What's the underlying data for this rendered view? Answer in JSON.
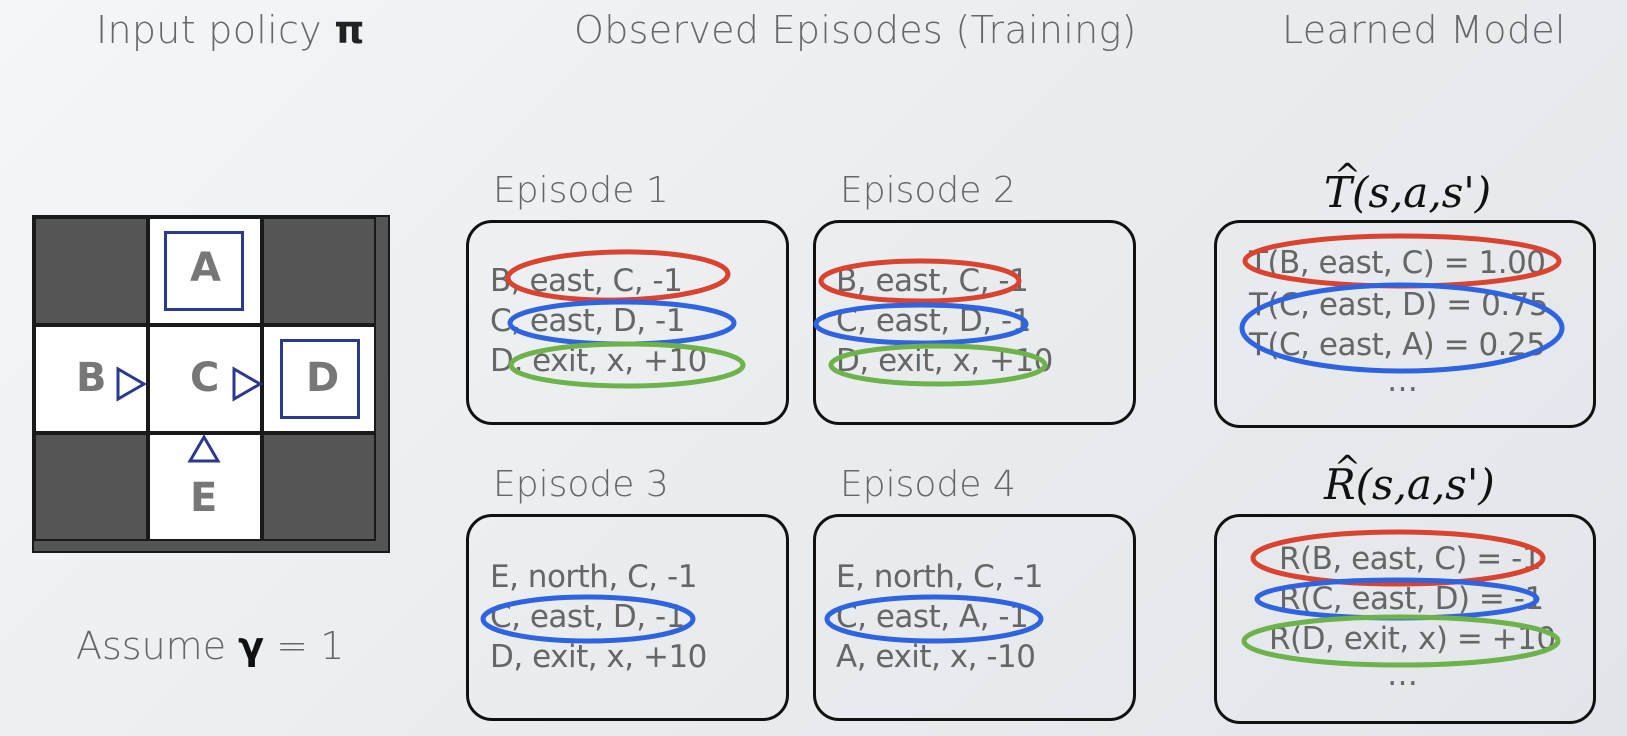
{
  "headers": {
    "policy": "Input policy",
    "policy_symbol": "π",
    "episodes": "Observed Episodes (Training)",
    "model": "Learned Model"
  },
  "grid": {
    "A": "A",
    "B": "B",
    "C": "C",
    "D": "D",
    "E": "E"
  },
  "assume": {
    "prefix": "Assume",
    "gamma": "γ",
    "suffix": "= 1"
  },
  "episodes": [
    {
      "title": "Episode 1",
      "lines": [
        "B, east, C, -1",
        "C, east, D, -1",
        "D, exit, x, +10"
      ]
    },
    {
      "title": "Episode 2",
      "lines": [
        "B, east, C, -1",
        "C, east, D, -1",
        "D, exit, x, +10"
      ]
    },
    {
      "title": "Episode 3",
      "lines": [
        "E, north, C, -1",
        "C, east, D, -1",
        "D, exit, x, +10"
      ]
    },
    {
      "title": "Episode 4",
      "lines": [
        "E, north, C, -1",
        "C, east, A, -1",
        "A, exit, x, -10"
      ]
    }
  ],
  "model": {
    "T_title": "T(s,a,s')",
    "T_lines": [
      "T(B, east, C) = 1.00",
      "T(C, east, D) = 0.75",
      "T(C, east, A) = 0.25",
      "…"
    ],
    "R_title": "R(s,a,s')",
    "R_lines": [
      "R(B, east, C) = -1",
      "R(C, east, D) = -1",
      "R(D, exit, x) = +10",
      "…"
    ]
  },
  "colors": {
    "red": "#d9432f",
    "blue": "#2f63e0",
    "green": "#6db24a",
    "arrow": "#2b3a8f"
  }
}
